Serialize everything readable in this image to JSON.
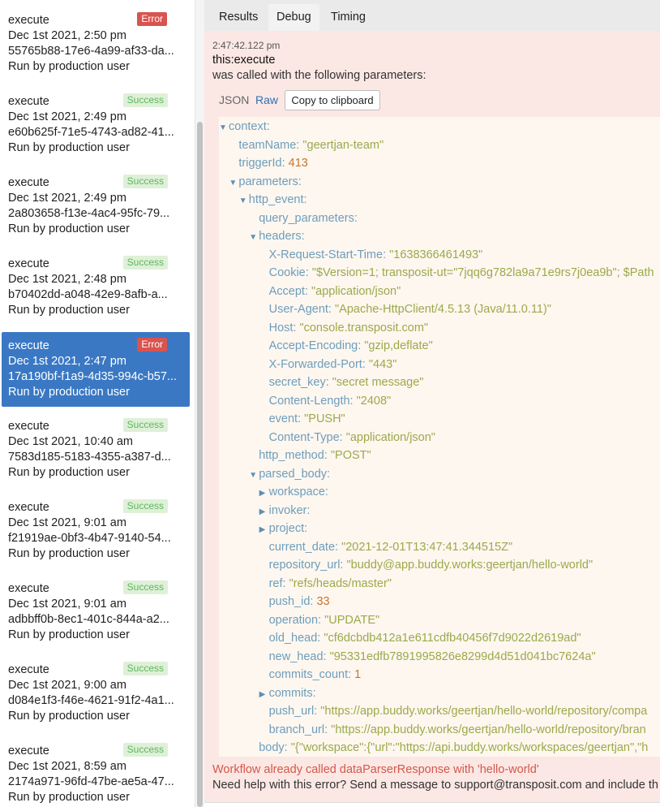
{
  "runs": [
    {
      "title": "execute",
      "status": "Error",
      "date": "Dec 1st 2021, 2:50 pm",
      "id": "55765b88-17e6-4a99-af33-da...",
      "by": "Run by production user"
    },
    {
      "title": "execute",
      "status": "Success",
      "date": "Dec 1st 2021, 2:49 pm",
      "id": "e60b625f-71e5-4743-ad82-41...",
      "by": "Run by production user"
    },
    {
      "title": "execute",
      "status": "Success",
      "date": "Dec 1st 2021, 2:49 pm",
      "id": "2a803658-f13e-4ac4-95fc-79...",
      "by": "Run by production user"
    },
    {
      "title": "execute",
      "status": "Success",
      "date": "Dec 1st 2021, 2:48 pm",
      "id": "b70402dd-a048-42e9-8afb-a...",
      "by": "Run by production user"
    },
    {
      "title": "execute",
      "status": "Error",
      "date": "Dec 1st 2021, 2:47 pm",
      "id": "17a190bf-f1a9-4d35-994c-b57...",
      "by": "Run by production user"
    },
    {
      "title": "execute",
      "status": "Success",
      "date": "Dec 1st 2021, 10:40 am",
      "id": "7583d185-5183-4355-a387-d...",
      "by": "Run by production user"
    },
    {
      "title": "execute",
      "status": "Success",
      "date": "Dec 1st 2021, 9:01 am",
      "id": "f21919ae-0bf3-4b47-9140-54...",
      "by": "Run by production user"
    },
    {
      "title": "execute",
      "status": "Success",
      "date": "Dec 1st 2021, 9:01 am",
      "id": "adbbff0b-8ec1-401c-844a-a2...",
      "by": "Run by production user"
    },
    {
      "title": "execute",
      "status": "Success",
      "date": "Dec 1st 2021, 9:00 am",
      "id": "d084e1f3-f46e-4621-91f2-4a1...",
      "by": "Run by production user"
    },
    {
      "title": "execute",
      "status": "Success",
      "date": "Dec 1st 2021, 8:59 am",
      "id": "2174a971-96fd-47be-ae5a-47...",
      "by": "Run by production user"
    }
  ],
  "tabs": {
    "results": "Results",
    "debug": "Debug",
    "timing": "Timing"
  },
  "debug": {
    "timestamp": "2:47:42.122 pm",
    "function": "this:execute",
    "description": "was called with the following parameters:",
    "view_json": "JSON",
    "view_raw": "Raw",
    "copy_label": "Copy to clipboard",
    "tree": [
      {
        "key": "context:",
        "toggle": "▼"
      },
      {
        "key": "teamName:",
        "str": "\"geertjan-team\""
      },
      {
        "key": "triggerId:",
        "num": "413"
      },
      {
        "key": "parameters:",
        "toggle": "▼"
      },
      {
        "key": "http_event:",
        "toggle": "▼"
      },
      {
        "key": "query_parameters:"
      },
      {
        "key": "headers:",
        "toggle": "▼"
      },
      {
        "key": "X-Request-Start-Time:",
        "str": "\"1638366461493\""
      },
      {
        "key": "Cookie:",
        "str": "\"$Version=1; transposit-ut=\"7jqq6g782la9a71e9rs7j0ea9b\"; $Path"
      },
      {
        "key": "Accept:",
        "str": "\"application/json\""
      },
      {
        "key": "User-Agent:",
        "str": "\"Apache-HttpClient/4.5.13 (Java/11.0.11)\""
      },
      {
        "key": "Host:",
        "str": "\"console.transposit.com\""
      },
      {
        "key": "Accept-Encoding:",
        "str": "\"gzip,deflate\""
      },
      {
        "key": "X-Forwarded-Port:",
        "str": "\"443\""
      },
      {
        "key": "secret_key:",
        "str": "\"secret message\""
      },
      {
        "key": "Content-Length:",
        "str": "\"2408\""
      },
      {
        "key": "event:",
        "str": "\"PUSH\""
      },
      {
        "key": "Content-Type:",
        "str": "\"application/json\""
      },
      {
        "key": "http_method:",
        "str": "\"POST\""
      },
      {
        "key": "parsed_body:",
        "toggle": "▼"
      },
      {
        "key": "workspace:",
        "toggle": "▶"
      },
      {
        "key": "invoker:",
        "toggle": "▶"
      },
      {
        "key": "project:",
        "toggle": "▶"
      },
      {
        "key": "current_date:",
        "str": "\"2021-12-01T13:47:41.344515Z\""
      },
      {
        "key": "repository_url:",
        "str": "\"buddy@app.buddy.works:geertjan/hello-world\""
      },
      {
        "key": "ref:",
        "str": "\"refs/heads/master\""
      },
      {
        "key": "push_id:",
        "num": "33"
      },
      {
        "key": "operation:",
        "str": "\"UPDATE\""
      },
      {
        "key": "old_head:",
        "str": "\"cf6dcbdb412a1e611cdfb40456f7d9022d2619ad\""
      },
      {
        "key": "new_head:",
        "str": "\"95331edfb7891995826e8299d4d51d041bc7624a\""
      },
      {
        "key": "commits_count:",
        "num": "1"
      },
      {
        "key": "commits:",
        "toggle": "▶"
      },
      {
        "key": "push_url:",
        "str": "\"https://app.buddy.works/geertjan/hello-world/repository/compa"
      },
      {
        "key": "branch_url:",
        "str": "\"https://app.buddy.works/geertjan/hello-world/repository/bran"
      },
      {
        "key": "body:",
        "str": "\"{\"workspace\":{\"url\":\"https://api.buddy.works/workspaces/geertjan\",\"h"
      }
    ],
    "error_message": "Workflow already called dataParserResponse with 'hello-world'",
    "help_message": "Need help with this error? Send a message to support@transposit.com and include th"
  },
  "colors": {
    "selected": "#3a78c4",
    "error_badge": "#d9534f",
    "success_badge": "#dff0d8",
    "panel": "#fbe8e4"
  }
}
